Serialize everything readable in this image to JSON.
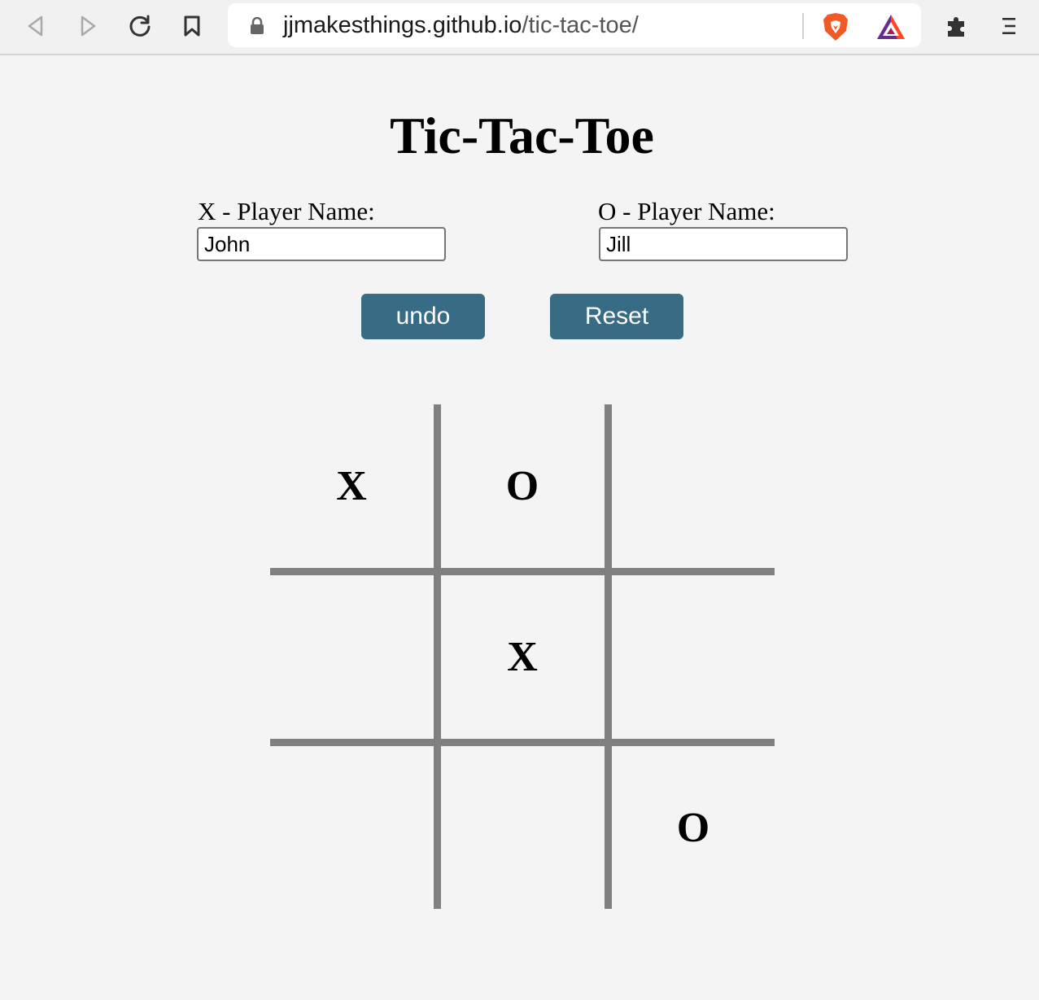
{
  "browser": {
    "url_host": "jjmakesthings.github.io",
    "url_path": "/tic-tac-toe/",
    "icons": [
      "back-icon",
      "forward-icon",
      "reload-icon",
      "bookmark-icon",
      "lock-icon",
      "brave-shields-icon",
      "bat-rewards-icon",
      "extensions-icon",
      "menu-icon"
    ],
    "colors": {
      "brave_orange": "#f15a24",
      "bat_purple": "#662d91"
    }
  },
  "game": {
    "title": "Tic-Tac-Toe",
    "x_player": {
      "label": "X - Player Name:",
      "value": "John"
    },
    "o_player": {
      "label": "O - Player Name:",
      "value": "Jill"
    },
    "undo_label": "undo",
    "reset_label": "Reset",
    "board": [
      [
        "X",
        "O",
        ""
      ],
      [
        "",
        "X",
        ""
      ],
      [
        "",
        "",
        "O"
      ]
    ],
    "colors": {
      "button_bg": "#386b84",
      "grid": "#808080",
      "page_bg": "#f4f4f4"
    }
  }
}
